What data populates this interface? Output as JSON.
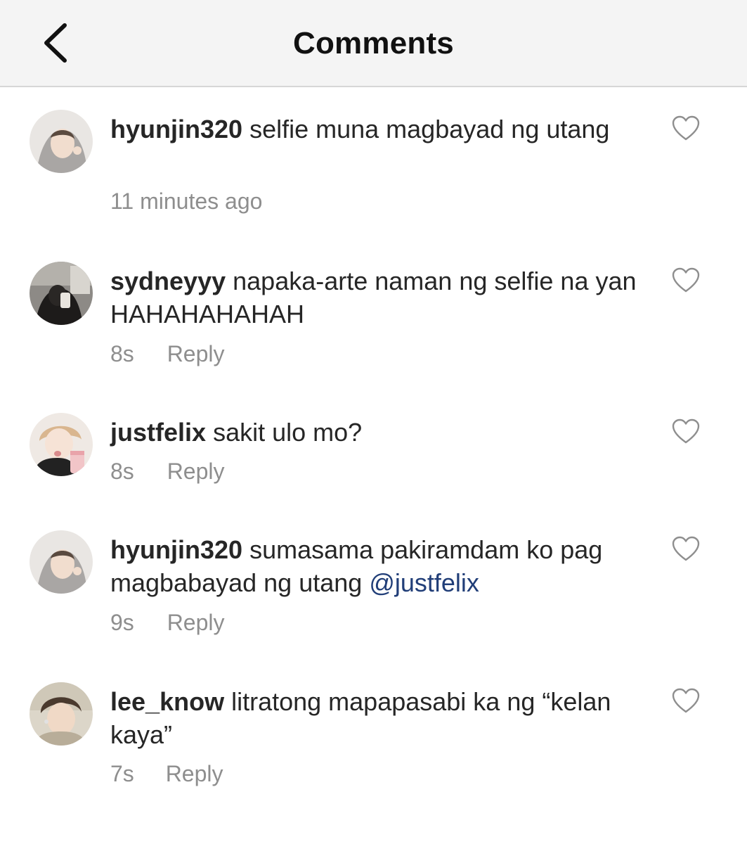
{
  "header": {
    "title": "Comments",
    "back_icon": "chevron-left-icon"
  },
  "colors": {
    "header_bg": "#f4f4f4",
    "text": "#262626",
    "secondary_text": "#8e8e8e",
    "mention": "#213e78"
  },
  "comments": [
    {
      "username": "hyunjin320",
      "text": "selfie muna magbayad ng utang",
      "mention": "",
      "time": "11 minutes ago",
      "reply": "",
      "like_icon": "heart-outline-icon"
    },
    {
      "username": "sydneyyy",
      "text": "napaka-arte naman ng selfie na yan HAHAHAHAHAH",
      "mention": "",
      "time": "8s",
      "reply": "Reply",
      "like_icon": "heart-outline-icon"
    },
    {
      "username": "justfelix",
      "text": "sakit ulo mo?",
      "mention": "",
      "time": "8s",
      "reply": "Reply",
      "like_icon": "heart-outline-icon"
    },
    {
      "username": "hyunjin320",
      "text": "sumasama pakiramdam ko pag magbabayad ng utang",
      "mention": "@justfelix",
      "time": "9s",
      "reply": "Reply",
      "like_icon": "heart-outline-icon"
    },
    {
      "username": "lee_know",
      "text": "litratong mapapasabi ka ng “kelan kaya”",
      "mention": "",
      "time": "7s",
      "reply": "Reply",
      "like_icon": "heart-outline-icon"
    }
  ]
}
